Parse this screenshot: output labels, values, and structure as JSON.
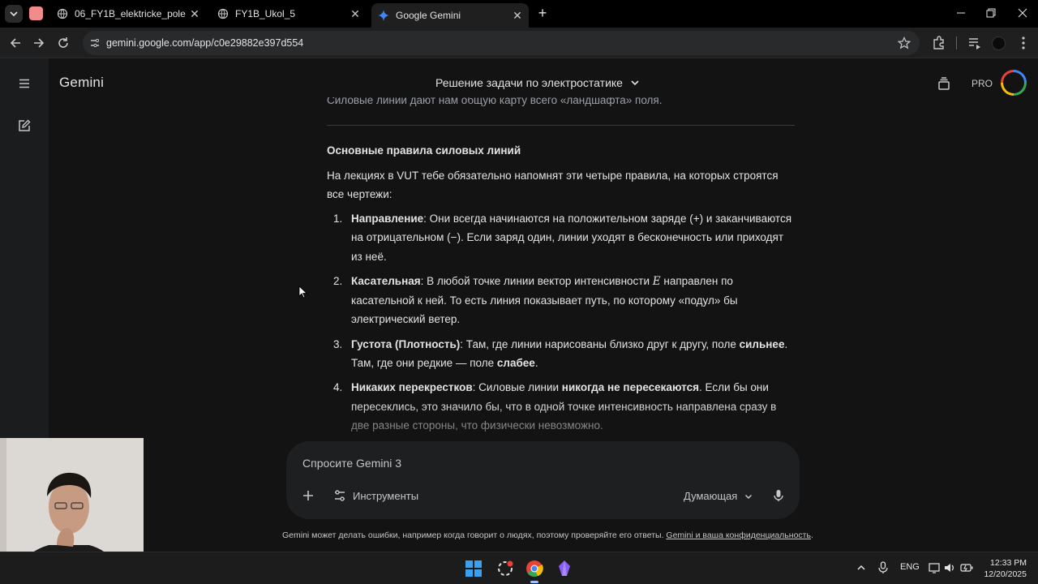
{
  "browser": {
    "tabs": [
      {
        "title": "06_FY1B_elektricke_pole",
        "active": false
      },
      {
        "title": "FY1B_Ukol_5",
        "active": false
      },
      {
        "title": "Google Gemini",
        "active": true
      }
    ],
    "url": "gemini.google.com/app/c0e29882e397d554"
  },
  "app": {
    "brand": "Gemini",
    "conversation_title": "Решение задачи по электростатике",
    "plan_badge": "PRO"
  },
  "message": {
    "cutoff_line": "Силовые линии дают нам общую карту всего «ландшафта» поля.",
    "heading": "Основные правила силовых линий",
    "intro": "На лекциях в VUT тебе обязательно напомнят эти четыре правила, на которых строятся все чертежи:",
    "rules": [
      {
        "num": "1.",
        "bold": "Направление",
        "text": ": Они всегда начинаются на положительном заряде (+) и заканчиваются на отрицательном (−). Если заряд один, линии уходят в бесконечность или приходят из неё."
      },
      {
        "num": "2.",
        "bold": "Касательная",
        "text_a": ": В любой точке линии вектор интенсивности ",
        "var": "E",
        "text_b": " направлен по касательной к ней. То есть линия показывает путь, по которому «подул» бы электрический ветер."
      },
      {
        "num": "3.",
        "bold": "Густота (Плотность)",
        "text_a": ": Там, где линии нарисованы близко друг к другу, поле ",
        "bold_b": "сильнее",
        "text_b": ". Там, где они редкие — поле ",
        "bold_c": "слабее",
        "text_c": "."
      },
      {
        "num": "4.",
        "bold": "Никаких перекрестков",
        "text_a": ": Силовые линии ",
        "bold_b": "никогда не пересекаются",
        "text_b": ". Если бы они пересеклись, это значило бы, что в одной точке интенсивность направлена сразу в две разные стороны, что физически невозможно."
      }
    ]
  },
  "composer": {
    "placeholder": "Спросите Gemini 3",
    "tools_label": "Инструменты",
    "mode_label": "Думающая"
  },
  "disclaimer": {
    "text": "Gemini может делать ошибки, например когда говорит о людях, поэтому проверяйте его ответы. ",
    "link": "Gemini и ваша конфиденциальность",
    "end": "."
  },
  "taskbar": {
    "lang": "ENG",
    "time": "12:33 PM",
    "date": "12/20/2025"
  },
  "colors": {
    "background": "#131314",
    "accent_red": "#ea4335",
    "accent_blue": "#4285f4"
  }
}
